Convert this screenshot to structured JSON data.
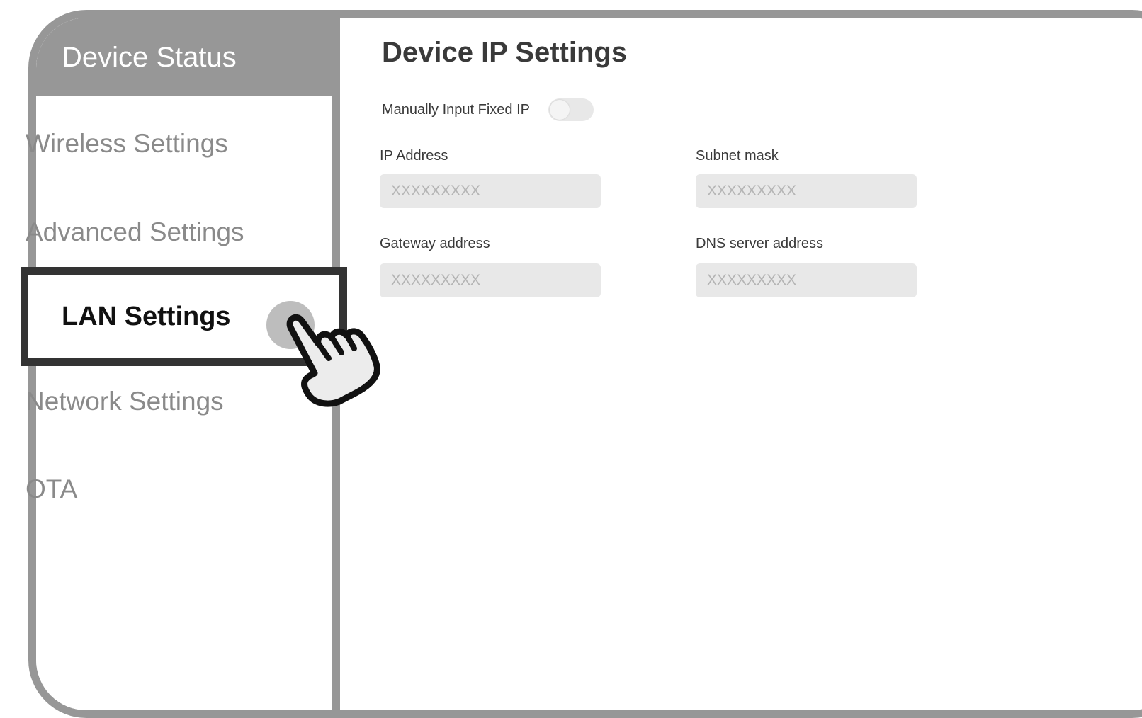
{
  "sidebar": {
    "header": "Device Status",
    "items": [
      {
        "label": "Wireless Settings"
      },
      {
        "label": "Advanced Settings"
      },
      {
        "label": "LAN Settings",
        "active": true
      },
      {
        "label": "Network Settings"
      },
      {
        "label": "OTA"
      }
    ]
  },
  "main": {
    "title": "Device IP Settings",
    "toggle": {
      "label": "Manually Input Fixed IP",
      "on": false
    },
    "fields": {
      "ip_address": {
        "label": "IP Address",
        "placeholder": "XXXXXXXXX"
      },
      "subnet_mask": {
        "label": "Subnet mask",
        "placeholder": "XXXXXXXXX"
      },
      "gateway": {
        "label": "Gateway address",
        "placeholder": "XXXXXXXXX"
      },
      "dns": {
        "label": "DNS server address",
        "placeholder": "XXXXXXXXX"
      }
    }
  },
  "icons": {
    "pointer": "pointing-hand-icon"
  },
  "colors": {
    "frame": "#979797",
    "highlight_border": "#333333",
    "input_bg": "#e8e8e8",
    "sidebar_text": "#8a8a8a"
  }
}
